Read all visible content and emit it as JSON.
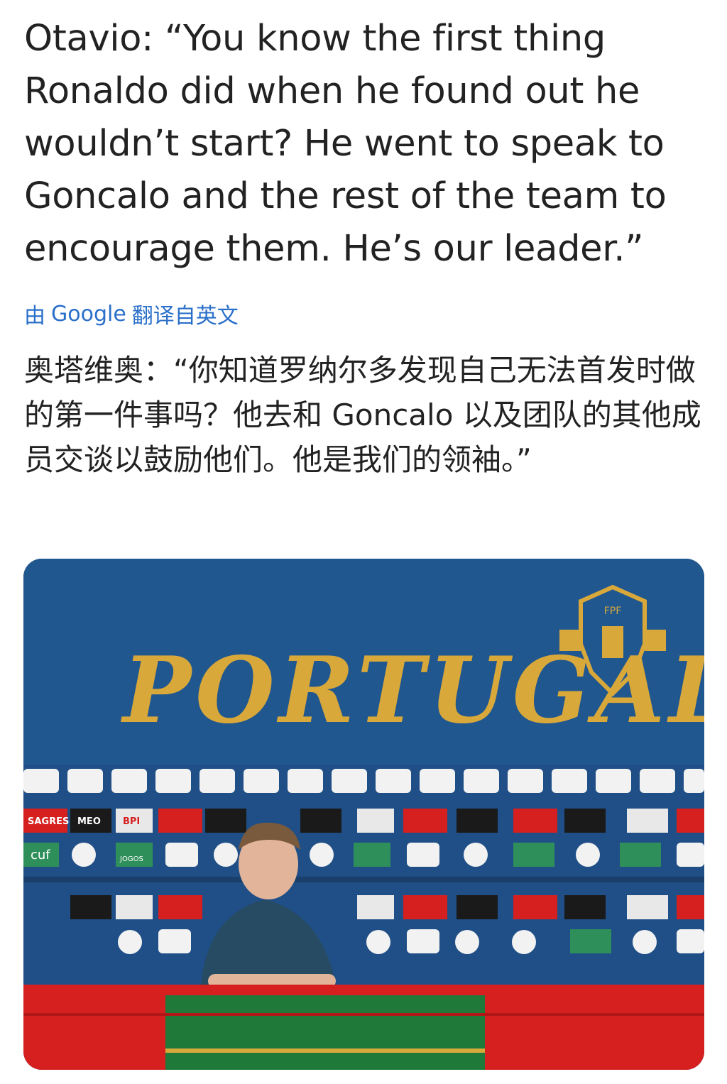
{
  "post": {
    "text": "Otavio: “You know the first thing Ronaldo did when he found out he wouldn’t start? He went to speak to Goncalo and the rest of the team to encourage them. He’s our leader.”"
  },
  "translation_bar": {
    "prefix": "由",
    "brand": "Google",
    "suffix": "翻译自英文"
  },
  "translation": {
    "text": "奥塔维奥：“你知道罗纳尔多发现自己无法首发时做的第一件事吗？他去和 Goncalo 以及团队的其他成员交谈以鼓励他们。他是我们的领袖。”"
  },
  "photo": {
    "banner_text": "PORTUGAL",
    "crest_text": "FPF",
    "sponsors": [
      "SAGRES",
      "MEO",
      "BPI",
      "cuf",
      "JOGOS"
    ],
    "colors": {
      "backdrop": "#1f4f86",
      "gold": "#d9a83a",
      "table_red": "#d61f1f",
      "table_green": "#1f7a3a"
    }
  }
}
